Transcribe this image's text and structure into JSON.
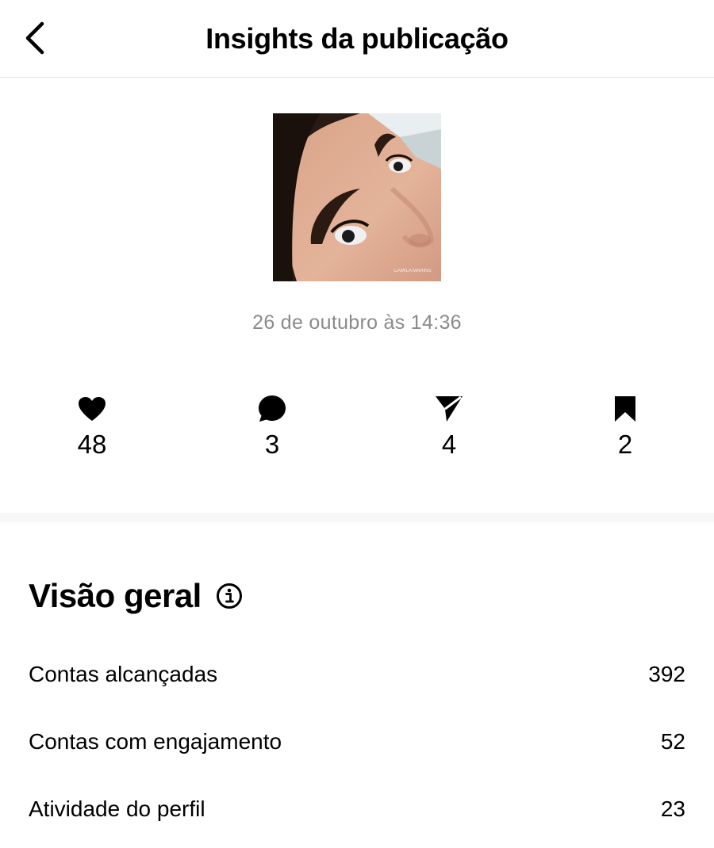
{
  "header": {
    "title": "Insights da publicação",
    "back_icon": "chevron-left-icon"
  },
  "post": {
    "date": "26 de outubro às 14:36",
    "watermark": "CAMILA MARINS"
  },
  "stats": [
    {
      "icon": "heart-icon",
      "value": "48"
    },
    {
      "icon": "comment-icon",
      "value": "3"
    },
    {
      "icon": "share-icon",
      "value": "4"
    },
    {
      "icon": "bookmark-icon",
      "value": "2"
    }
  ],
  "overview": {
    "title": "Visão geral",
    "rows": [
      {
        "label": "Contas alcançadas",
        "value": "392"
      },
      {
        "label": "Contas com engajamento",
        "value": "52"
      },
      {
        "label": "Atividade do perfil",
        "value": "23"
      }
    ]
  },
  "colors": {
    "text": "#000000",
    "muted": "#8a8a8a",
    "divider": "#e6e6e6",
    "section_bg": "#f7f7f7"
  }
}
